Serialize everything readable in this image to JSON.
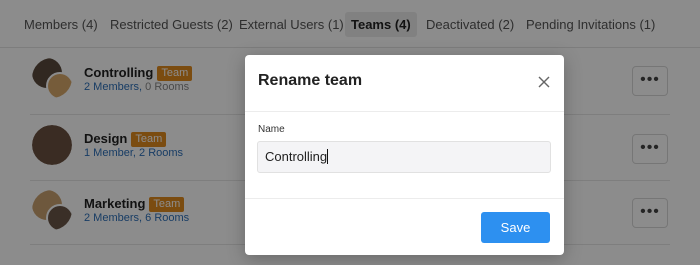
{
  "tabs": [
    {
      "label": "Members (4)",
      "active": false
    },
    {
      "label": "Restricted Guests (2)",
      "active": false
    },
    {
      "label": "External Users (1)",
      "active": false
    },
    {
      "label": "Teams (4)",
      "active": true
    },
    {
      "label": "Deactivated (2)",
      "active": false
    },
    {
      "label": "Pending Invitations (1)",
      "active": false
    }
  ],
  "teams": [
    {
      "name": "Controlling",
      "badge": "Team",
      "members": "2 Members,",
      "rooms": "0 Rooms"
    },
    {
      "name": "Design",
      "badge": "Team",
      "members": "1 Member,",
      "rooms": "2 Rooms"
    },
    {
      "name": "Marketing",
      "badge": "Team",
      "members": "2 Members,",
      "rooms": "6 Rooms"
    }
  ],
  "more_label": "•••",
  "modal": {
    "title": "Rename team",
    "field_label": "Name",
    "field_value": "Controlling",
    "save_label": "Save"
  },
  "colors": {
    "accent": "#2d90f0",
    "badge": "#e08a1e",
    "link": "#2d6fb8"
  }
}
